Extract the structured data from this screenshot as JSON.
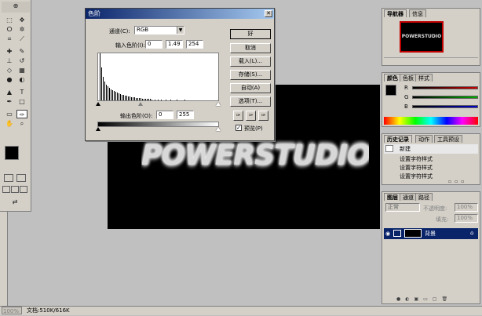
{
  "dialog": {
    "title": "色阶",
    "channel_label": "通道(C):",
    "channel_value": "RGB",
    "input_label": "输入色阶(I):",
    "input_black": "0",
    "input_gamma": "1.49",
    "input_white": "254",
    "output_label": "输出色阶(O):",
    "output_black": "0",
    "output_white": "255",
    "buttons": [
      "好",
      "取消",
      "载入(L)...",
      "存储(S)...",
      "自动(A)",
      "选项(T)..."
    ],
    "preview_label": "预览(P)",
    "preview_checked": true
  },
  "canvas": {
    "text": "POWERSTUDIO"
  },
  "navigator": {
    "tabs": [
      "导航器",
      "信息"
    ],
    "thumb_text": "POWERSTUDIO"
  },
  "color_panel": {
    "tabs": [
      "颜色",
      "色板",
      "样式"
    ],
    "channels": [
      {
        "name": "R",
        "color": "#cc0000"
      },
      {
        "name": "G",
        "color": "#00aa00"
      },
      {
        "name": "B",
        "color": "#0000cc"
      }
    ]
  },
  "history": {
    "tabs": [
      "历史记录",
      "动作",
      "工具预设"
    ],
    "items": [
      "新建",
      "设置字符样式",
      "设置字符样式",
      "设置字符样式"
    ]
  },
  "layers": {
    "tabs": [
      "图层",
      "通道",
      "路径"
    ],
    "blend_mode": "正常",
    "opacity_label": "不透明度:",
    "opacity_value": "100%",
    "fill_label": "填充:",
    "fill_value": "100%",
    "layer_name": "背景"
  },
  "status": {
    "zoom": "100%",
    "doc_info": "文档:510K/616K"
  },
  "colors": {
    "selection": "#0a246a",
    "canvas": "#000000",
    "chrome": "#d4d0c8"
  }
}
